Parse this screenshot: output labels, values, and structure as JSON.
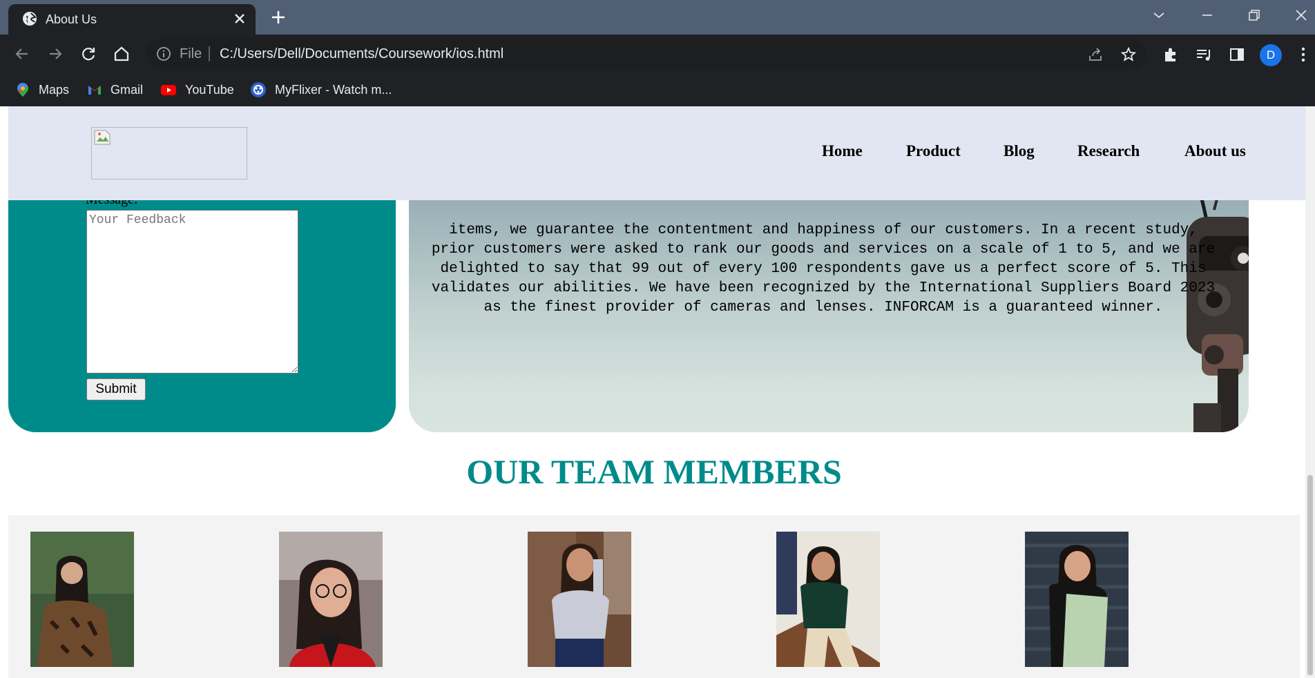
{
  "browser": {
    "tab": {
      "title": "About Us",
      "icon": "globe-icon"
    },
    "address": {
      "scheme": "File",
      "url": "C:/Users/Dell/Documents/Coursework/ios.html"
    },
    "profile_initial": "D",
    "bookmarks": [
      {
        "label": "Maps",
        "icon": "maps-icon"
      },
      {
        "label": "Gmail",
        "icon": "gmail-icon"
      },
      {
        "label": "YouTube",
        "icon": "youtube-icon"
      },
      {
        "label": "MyFlixer - Watch m...",
        "icon": "myflixer-icon"
      }
    ]
  },
  "header": {
    "nav": [
      "Home",
      "Product",
      "Blog",
      "Research",
      "About us"
    ]
  },
  "feedback_form": {
    "message_label": "Message:",
    "message_placeholder": "Your Feedback",
    "submit_label": "Submit"
  },
  "about": {
    "text": "items, we guarantee the contentment and happiness of our customers. In a recent study, prior customers were asked to rank our goods and services on a scale of 1 to 5, and we are delighted to say that 99 out of every 100 respondents gave us a perfect score of 5. This validates our abilities. We have been recognized by the International Suppliers Board 2023 as the finest provider of cameras and lenses. INFORCAM is a guaranteed winner."
  },
  "team": {
    "heading": "OUR TEAM MEMBERS",
    "members_count_visible": 5
  },
  "colors": {
    "accent": "#008b8b",
    "header_bg": "#e2e6f3",
    "chrome_dark": "#202124",
    "tabstrip": "#505f73"
  }
}
